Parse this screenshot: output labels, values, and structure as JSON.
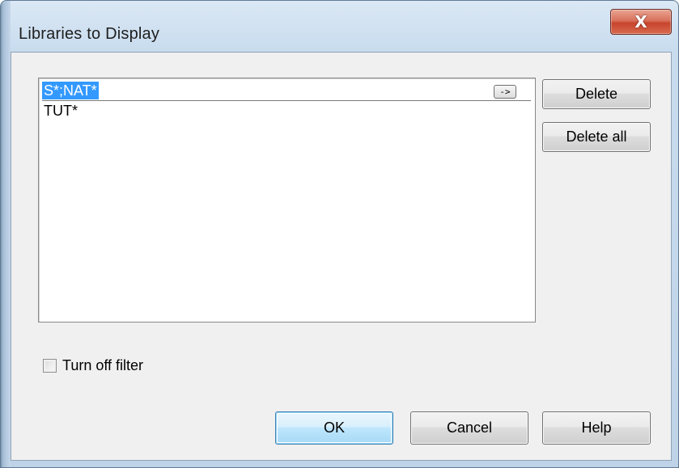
{
  "window": {
    "title": "Libraries to Display",
    "close_label": "X"
  },
  "list": {
    "edit_value": "S*;NAT*",
    "arrow_button_label": "->",
    "items": [
      "TUT*"
    ]
  },
  "buttons": {
    "delete": "Delete",
    "delete_all": "Delete all",
    "ok": "OK",
    "cancel": "Cancel",
    "help": "Help"
  },
  "checkbox": {
    "label": "Turn off filter",
    "checked": false
  },
  "colors": {
    "selection": "#3399ff",
    "close_button": "#c7442c",
    "dialog_background": "#f0f0f0"
  }
}
